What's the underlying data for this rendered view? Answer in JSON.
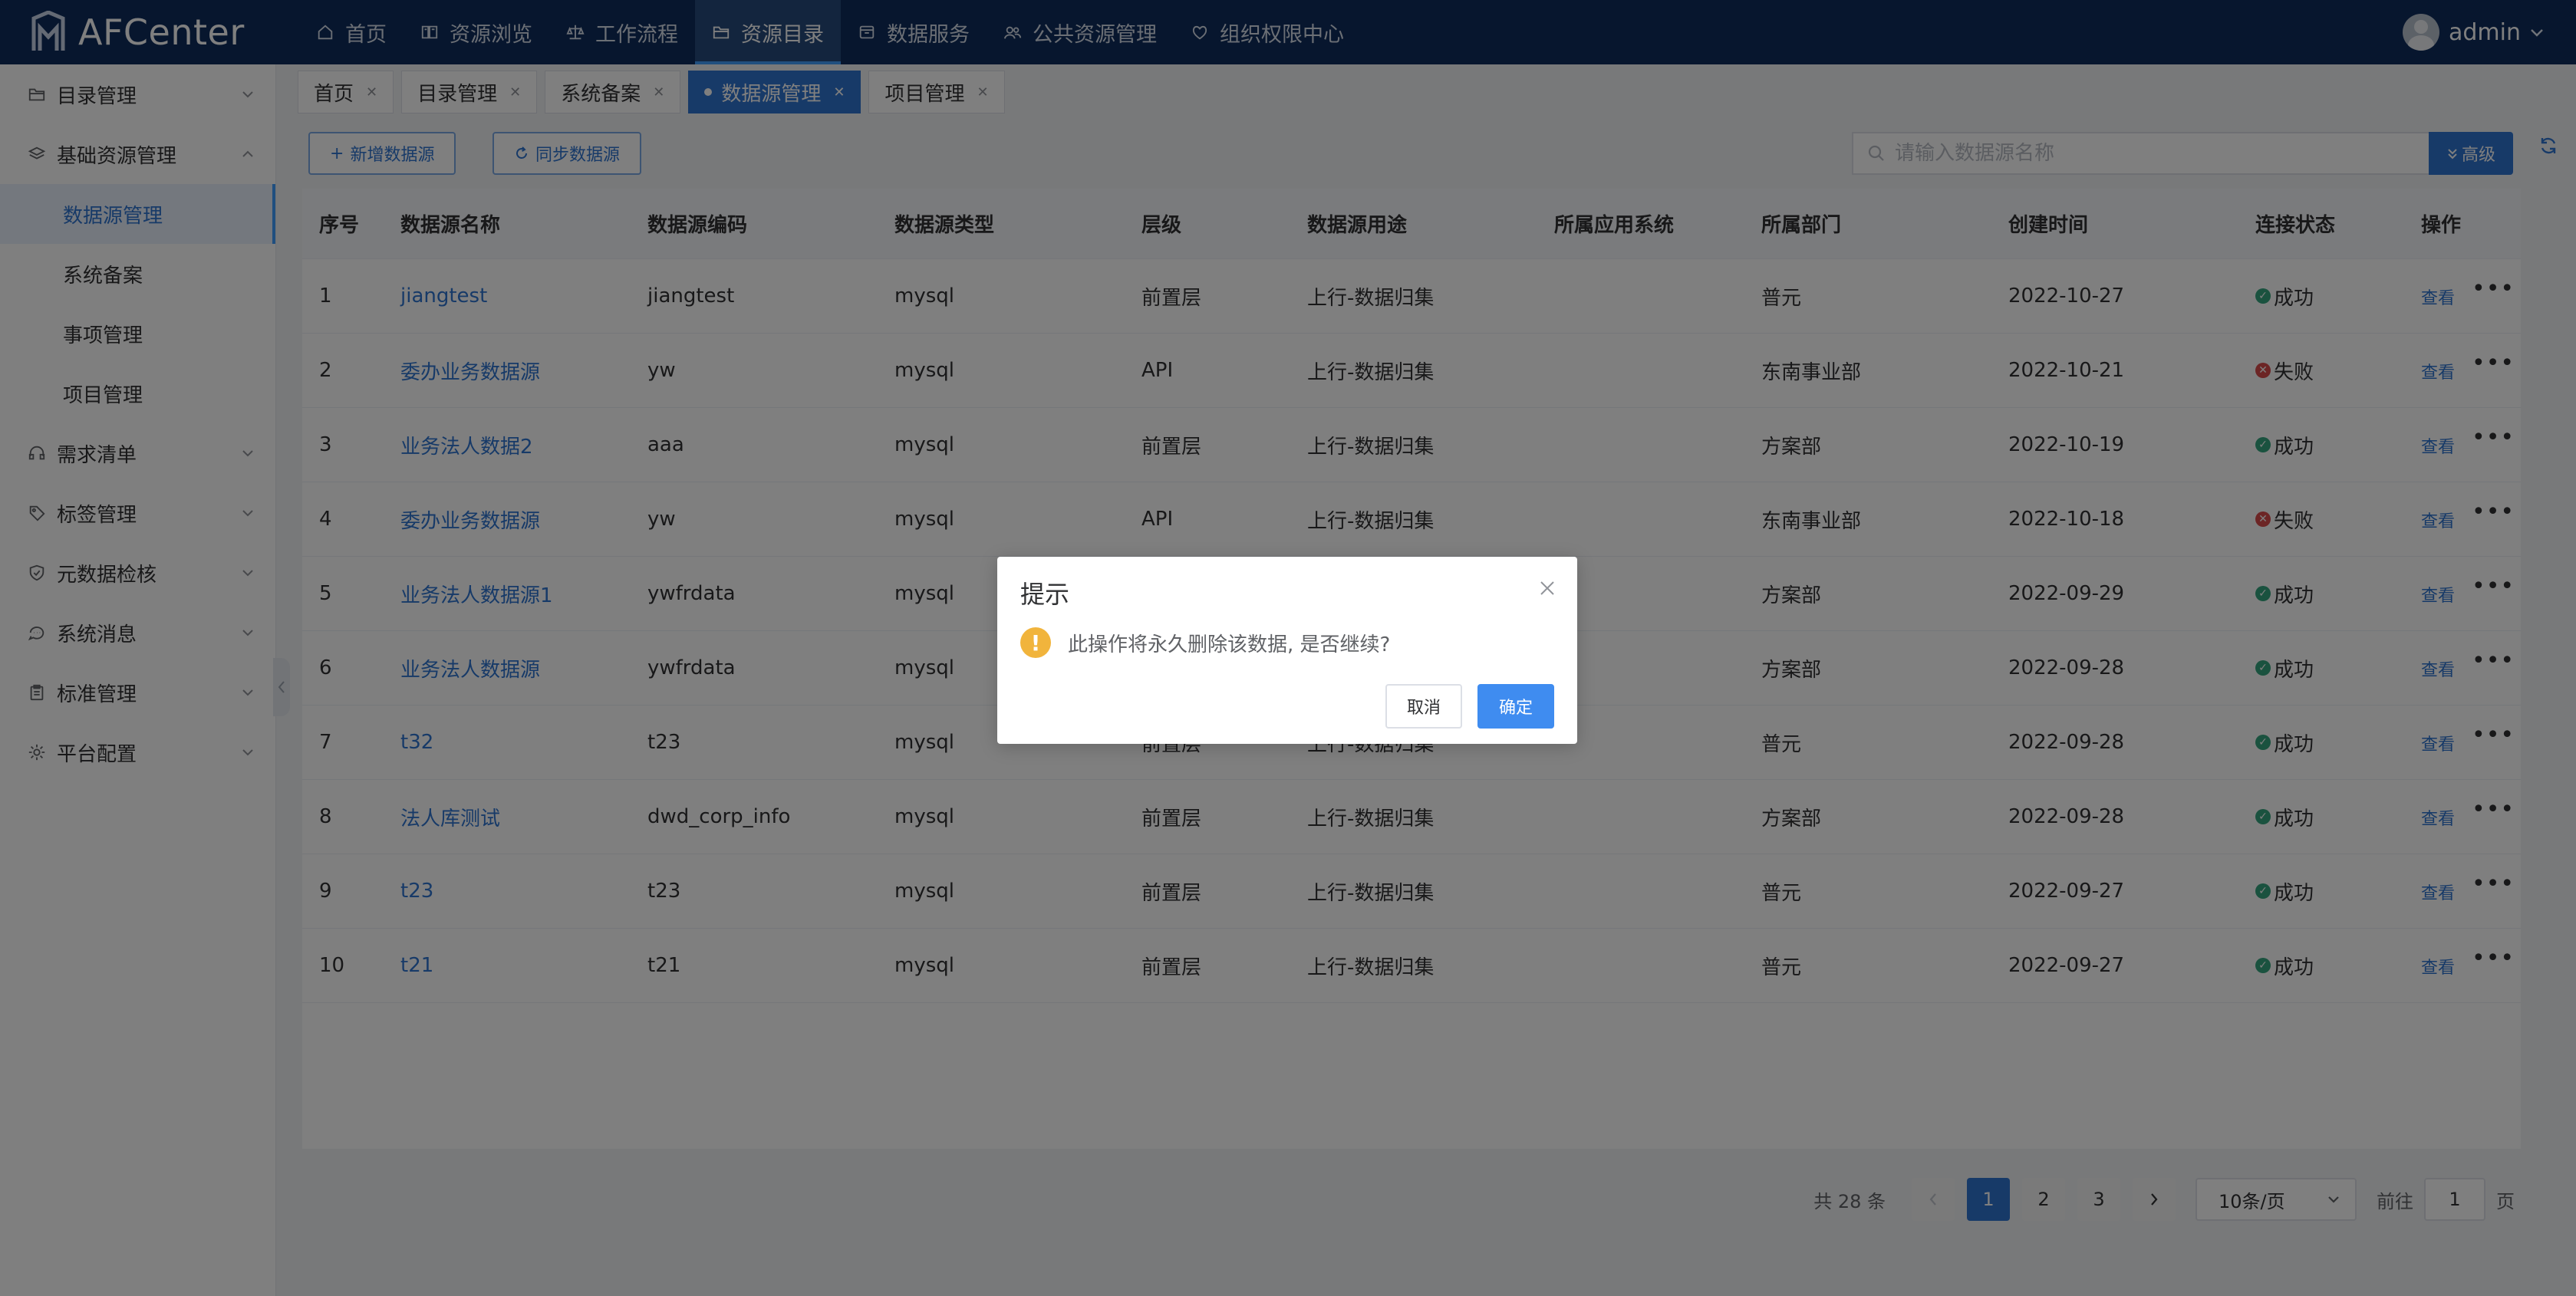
{
  "header": {
    "brand": "AFCenter",
    "nav": [
      {
        "label": "首页",
        "icon": "home-icon"
      },
      {
        "label": "资源浏览",
        "icon": "book-icon"
      },
      {
        "label": "工作流程",
        "icon": "scale-icon"
      },
      {
        "label": "资源目录",
        "icon": "folder-icon",
        "active": true
      },
      {
        "label": "数据服务",
        "icon": "box-icon"
      },
      {
        "label": "公共资源管理",
        "icon": "users-icon"
      },
      {
        "label": "组织权限中心",
        "icon": "heart-shield-icon"
      }
    ],
    "user": "admin"
  },
  "sidebar": {
    "groups": [
      {
        "label": "目录管理",
        "icon": "folder-icon",
        "expanded": false
      },
      {
        "label": "基础资源管理",
        "icon": "layers-icon",
        "expanded": true,
        "children": [
          {
            "label": "数据源管理",
            "active": true
          },
          {
            "label": "系统备案"
          },
          {
            "label": "事项管理"
          },
          {
            "label": "项目管理"
          }
        ]
      },
      {
        "label": "需求清单",
        "icon": "headset-icon",
        "expanded": false
      },
      {
        "label": "标签管理",
        "icon": "tag-icon",
        "expanded": false
      },
      {
        "label": "元数据检核",
        "icon": "shield-check-icon",
        "expanded": false
      },
      {
        "label": "系统消息",
        "icon": "chat-icon",
        "expanded": false
      },
      {
        "label": "标准管理",
        "icon": "clipboard-icon",
        "expanded": false
      },
      {
        "label": "平台配置",
        "icon": "gear-icon",
        "expanded": false
      }
    ]
  },
  "tabs": [
    {
      "label": "首页"
    },
    {
      "label": "目录管理"
    },
    {
      "label": "系统备案"
    },
    {
      "label": "数据源管理",
      "active": true
    },
    {
      "label": "项目管理"
    }
  ],
  "toolbar": {
    "add_label": "新增数据源",
    "sync_label": "同步数据源",
    "search_placeholder": "请输入数据源名称",
    "advanced_label": "高级"
  },
  "table": {
    "columns": [
      "序号",
      "数据源名称",
      "数据源编码",
      "数据源类型",
      "层级",
      "数据源用途",
      "所属应用系统",
      "所属部门",
      "创建时间",
      "连接状态",
      "操作"
    ],
    "view_label": "查看",
    "rows": [
      {
        "no": "1",
        "name": "jiangtest",
        "code": "jiangtest",
        "type": "mysql",
        "level": "前置层",
        "usage": "上行-数据归集",
        "app": "",
        "dept": "普元",
        "created": "2022-10-27",
        "status": "成功",
        "ok": true
      },
      {
        "no": "2",
        "name": "委办业务数据源",
        "code": "yw",
        "type": "mysql",
        "level": "API",
        "usage": "上行-数据归集",
        "app": "",
        "dept": "东南事业部",
        "created": "2022-10-21",
        "status": "失败",
        "ok": false
      },
      {
        "no": "3",
        "name": "业务法人数据2",
        "code": "aaa",
        "type": "mysql",
        "level": "前置层",
        "usage": "上行-数据归集",
        "app": "",
        "dept": "方案部",
        "created": "2022-10-19",
        "status": "成功",
        "ok": true
      },
      {
        "no": "4",
        "name": "委办业务数据源",
        "code": "yw",
        "type": "mysql",
        "level": "API",
        "usage": "上行-数据归集",
        "app": "",
        "dept": "东南事业部",
        "created": "2022-10-18",
        "status": "失败",
        "ok": false
      },
      {
        "no": "5",
        "name": "业务法人数据源1",
        "code": "ywfrdata",
        "type": "mysql",
        "level": "",
        "usage": "",
        "app": "",
        "dept": "方案部",
        "created": "2022-09-29",
        "status": "成功",
        "ok": true
      },
      {
        "no": "6",
        "name": "业务法人数据源",
        "code": "ywfrdata",
        "type": "mysql",
        "level": "",
        "usage": "",
        "app": "",
        "dept": "方案部",
        "created": "2022-09-28",
        "status": "成功",
        "ok": true
      },
      {
        "no": "7",
        "name": "t32",
        "code": "t23",
        "type": "mysql",
        "level": "前置层",
        "usage": "上行-数据归集",
        "app": "",
        "dept": "普元",
        "created": "2022-09-28",
        "status": "成功",
        "ok": true
      },
      {
        "no": "8",
        "name": "法人库测试",
        "code": "dwd_corp_info",
        "type": "mysql",
        "level": "前置层",
        "usage": "上行-数据归集",
        "app": "",
        "dept": "方案部",
        "created": "2022-09-28",
        "status": "成功",
        "ok": true
      },
      {
        "no": "9",
        "name": "t23",
        "code": "t23",
        "type": "mysql",
        "level": "前置层",
        "usage": "上行-数据归集",
        "app": "",
        "dept": "普元",
        "created": "2022-09-27",
        "status": "成功",
        "ok": true
      },
      {
        "no": "10",
        "name": "t21",
        "code": "t21",
        "type": "mysql",
        "level": "前置层",
        "usage": "上行-数据归集",
        "app": "",
        "dept": "普元",
        "created": "2022-09-27",
        "status": "成功",
        "ok": true
      }
    ]
  },
  "pagination": {
    "total_label": "共 28 条",
    "pages": [
      "1",
      "2",
      "3"
    ],
    "current": "1",
    "page_size": "10条/页",
    "goto_label": "前往",
    "goto_value": "1",
    "page_suffix": "页"
  },
  "dialog": {
    "title": "提示",
    "message": "此操作将永久删除该数据, 是否继续?",
    "cancel_label": "取消",
    "confirm_label": "确定"
  },
  "colors": {
    "header_bg": "#0f2c5c",
    "primary": "#2f74d0",
    "success": "#35a57e",
    "danger": "#d84a4a",
    "warning": "#f1b43c"
  }
}
